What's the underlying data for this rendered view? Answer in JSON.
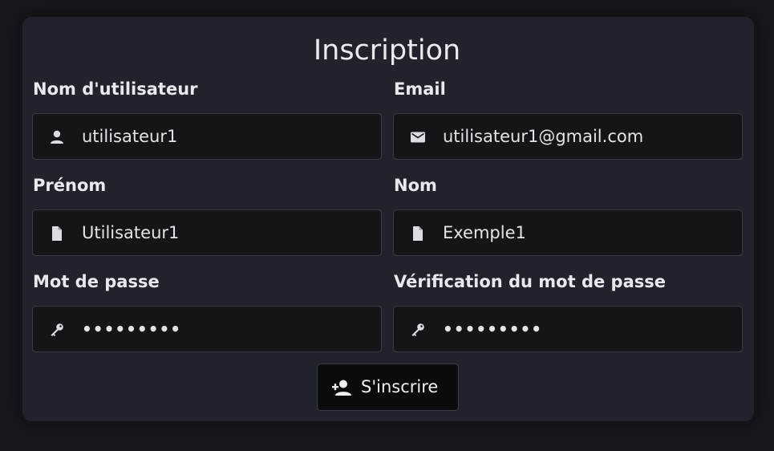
{
  "form": {
    "title": "Inscription",
    "fields": [
      {
        "label": "Nom d'utilisateur",
        "value": "utilisateur1",
        "icon": "user-icon"
      },
      {
        "label": "Email",
        "value": "utilisateur1@gmail.com",
        "icon": "envelope-icon"
      },
      {
        "label": "Prénom",
        "value": "Utilisateur1",
        "icon": "file-icon"
      },
      {
        "label": "Nom",
        "value": "Exemple1",
        "icon": "file-icon"
      },
      {
        "label": "Mot de passe",
        "value": "•••••••••",
        "icon": "key-icon"
      },
      {
        "label": "Vérification du mot de passe",
        "value": "•••••••••",
        "icon": "key-icon"
      }
    ],
    "submit_label": "S'inscrire",
    "submit_icon": "user-plus-icon"
  },
  "colors": {
    "page_background": "#17181d",
    "card_background": "#21232c",
    "input_background": "#141519",
    "button_background": "#0b0b0d",
    "text": "#e8e9ed"
  }
}
